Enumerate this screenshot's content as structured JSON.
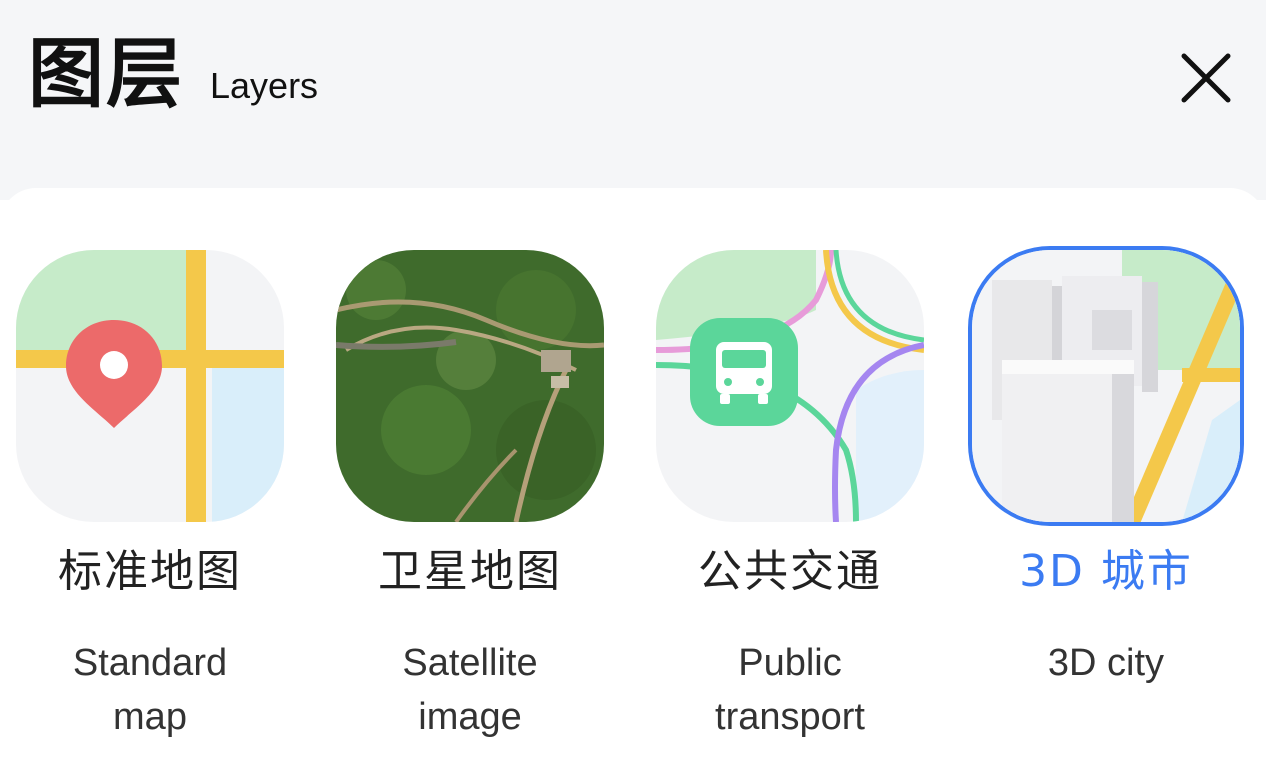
{
  "header": {
    "title_cn": "图层",
    "title_en": "Layers",
    "close_icon": "close-icon"
  },
  "layers": [
    {
      "cn": "标准地图",
      "en_line1": "Standard",
      "en_line2": "map",
      "icon": "standard-map-icon",
      "selected": false
    },
    {
      "cn": "卫星地图",
      "en_line1": "Satellite",
      "en_line2": "image",
      "icon": "satellite-map-icon",
      "selected": false
    },
    {
      "cn": "公共交通",
      "en_line1": "Public",
      "en_line2": "transport",
      "icon": "public-transport-icon",
      "selected": false
    },
    {
      "cn": "3D 城市",
      "en_line1": "3D city",
      "en_line2": "",
      "icon": "3d-city-icon",
      "selected": true
    }
  ],
  "colors": {
    "accent": "#3b7bf2",
    "header_bg": "#f5f6f8",
    "road_yellow": "#f4c84a",
    "park_green": "#c6ebc9",
    "water_blue": "#d9eefa",
    "pin_red": "#ec6a6a",
    "bus_green": "#5bd69a"
  }
}
